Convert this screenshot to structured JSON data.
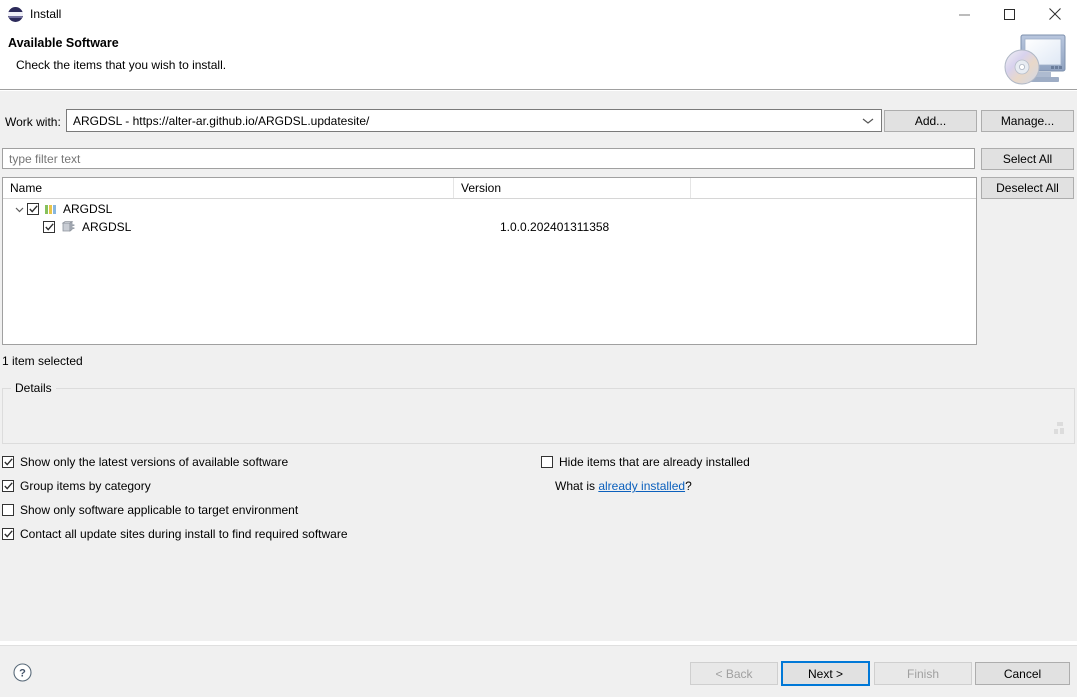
{
  "window": {
    "title": "Install",
    "logo_icon": "eclipse-logo-icon",
    "controls": {
      "minimize": "minimize-icon",
      "maximize": "maximize-icon",
      "close": "close-icon"
    }
  },
  "header": {
    "title": "Available Software",
    "subtitle": "Check the items that you wish to install.",
    "banner_icon": "monitor-cd-icon"
  },
  "work_with": {
    "label": "Work with:",
    "value": "ARGDSL - https://alter-ar.github.io/ARGDSL.updatesite/",
    "arrow_icon": "chevron-down-icon",
    "add_label": "Add...",
    "manage_label": "Manage..."
  },
  "filter": {
    "placeholder": "type filter text",
    "value": ""
  },
  "side_buttons": {
    "select_all": "Select All",
    "deselect_all": "Deselect All"
  },
  "tree": {
    "columns": [
      "Name",
      "Version"
    ],
    "rows": [
      {
        "name": "ARGDSL",
        "version": "",
        "checked": true,
        "expanded": true,
        "level": 0,
        "icon": "category-bars-icon",
        "expander_icon": "chevron-down-icon"
      },
      {
        "name": "ARGDSL",
        "version": "1.0.0.202401311358",
        "checked": true,
        "expanded": false,
        "level": 1,
        "icon": "feature-plugin-icon",
        "expander_icon": ""
      }
    ]
  },
  "status": {
    "selected_text": "1 item selected"
  },
  "details": {
    "legend": "Details",
    "content": "",
    "grip_icon": "resize-grip-icon"
  },
  "options": {
    "left": [
      {
        "label": "Show only the latest versions of available software",
        "checked": true
      },
      {
        "label": "Group items by category",
        "checked": true
      },
      {
        "label": "Show only software applicable to target environment",
        "checked": false
      },
      {
        "label": "Contact all update sites during install to find required software",
        "checked": true
      }
    ],
    "right": [
      {
        "label": "Hide items that are already installed",
        "checked": false
      }
    ],
    "what_is_prefix": "What is ",
    "what_is_link": "already installed",
    "what_is_suffix": "?"
  },
  "footer": {
    "help_icon": "help-question-icon",
    "back_label": "< Back",
    "next_label": "Next >",
    "finish_label": "Finish",
    "cancel_label": "Cancel"
  },
  "colors": {
    "body_bg": "#f0f0f0",
    "header_bg": "#ffffff",
    "focus_border": "#0078d7",
    "link": "#0b60bd",
    "placeholder": "#767676",
    "disabled_text": "#a0a0a0"
  }
}
